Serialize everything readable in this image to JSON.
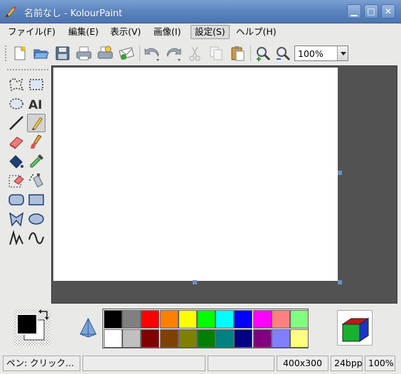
{
  "window": {
    "title": "名前なし - KolourPaint",
    "minimize_glyph": "▁",
    "maximize_glyph": "□",
    "close_glyph": "✕"
  },
  "menu": {
    "items": [
      "ファイル(F)",
      "編集(E)",
      "表示(V)",
      "画像(I)",
      "設定(S)",
      "ヘルプ(H)"
    ],
    "active_index": 4
  },
  "toolbar": {
    "buttons": [
      "new-document-icon",
      "open-folder-icon",
      "save-disk-icon",
      "print-icon",
      "print-preview-icon",
      "email-icon",
      "undo-icon",
      "redo-icon",
      "cut-icon",
      "copy-icon",
      "paste-icon",
      "zoom-in-icon",
      "zoom-out-icon"
    ],
    "zoom_value": "100%"
  },
  "tools": [
    "free-form-selection-icon",
    "rectangular-selection-icon",
    "elliptical-selection-icon",
    "text-tool-icon",
    "line-tool-icon",
    "pen-tool-icon",
    "eraser-tool-icon",
    "brush-tool-icon",
    "flood-fill-icon",
    "color-picker-icon",
    "color-eraser-icon",
    "spraycan-icon",
    "rounded-rectangle-icon",
    "rectangle-icon",
    "polygon-icon",
    "ellipse-icon",
    "connected-lines-icon",
    "curve-icon"
  ],
  "selected_tool_index": 5,
  "text_tool_label": "AI",
  "colors": {
    "foreground": "#000000",
    "background": "#ffffff",
    "palette_row1": [
      "#000000",
      "#808080",
      "#ff0000",
      "#ff8000",
      "#ffff00",
      "#00ff00",
      "#00ffff",
      "#0000ff",
      "#ff00ff",
      "#ff8080",
      "#80ff80"
    ],
    "palette_row2": [
      "#ffffff",
      "#c0c0c0",
      "#800000",
      "#804000",
      "#808000",
      "#008000",
      "#008080",
      "#000080",
      "#800080",
      "#8080ff",
      "#ffff80"
    ],
    "canvas_area_bg": "#525252"
  },
  "status": {
    "message": "ペン: クリック...",
    "size": "400x300",
    "depth": "24bpp",
    "zoom": "100%"
  }
}
